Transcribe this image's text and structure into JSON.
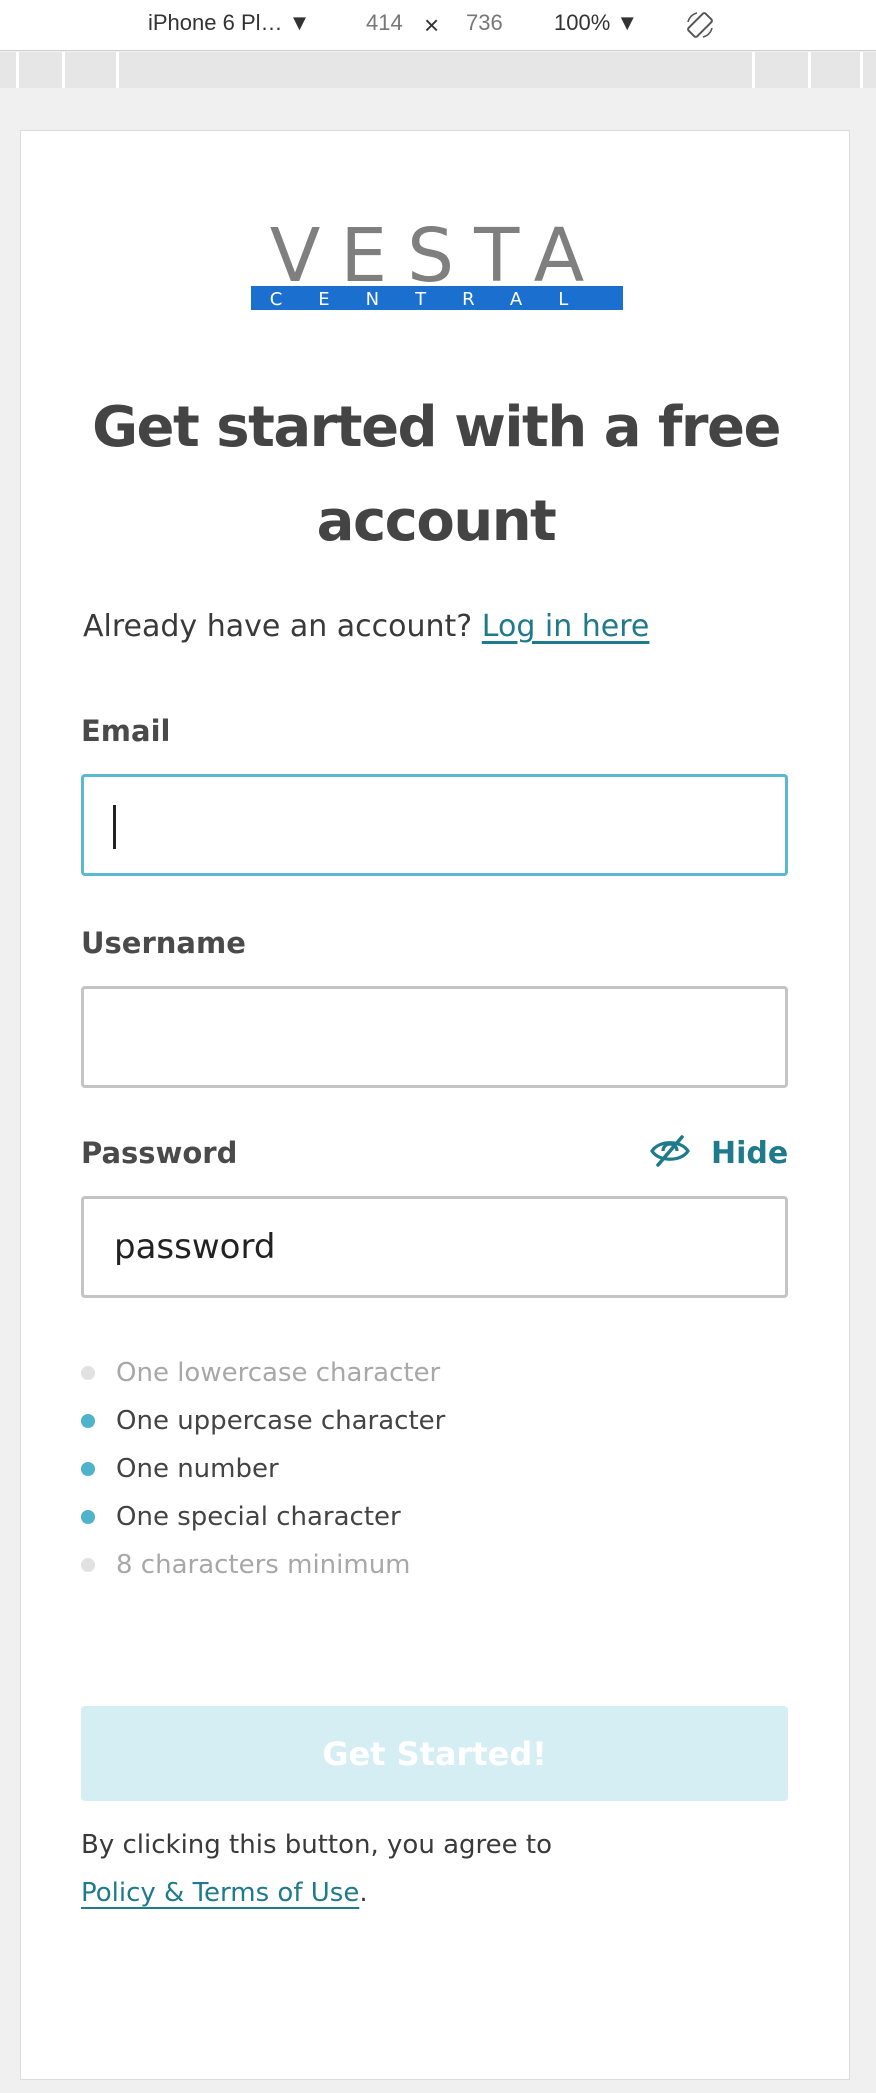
{
  "devtools": {
    "device": "iPhone 6 Pl…",
    "dropdown_arrow": "▼",
    "width": "414",
    "times": "×",
    "height": "736",
    "zoom": "100%",
    "rotate_icon": "rotate-icon"
  },
  "page": {
    "logo": {
      "wordmark": "VESTA",
      "sub": "CENTRAL",
      "sub_color": "#1a6fcf",
      "mark_color": "#7f7f80"
    },
    "heading": "Get started with a free account",
    "already_text": "Already have an account?",
    "login_link": "Log in here",
    "email": {
      "label": "Email",
      "value": "",
      "placeholder": ""
    },
    "username": {
      "label": "Username",
      "value": "",
      "placeholder": ""
    },
    "password": {
      "label": "Password",
      "value": "password",
      "toggle_label": "Hide",
      "toggle_icon": "eye-slash-icon"
    },
    "requirements": [
      {
        "text": "One lowercase character",
        "met": false
      },
      {
        "text": "One uppercase character",
        "met": true
      },
      {
        "text": "One number",
        "met": true
      },
      {
        "text": "One special character",
        "met": true
      },
      {
        "text": "8 characters minimum",
        "met": false
      }
    ],
    "submit_label": "Get Started!",
    "terms_prefix": "By clicking this button, you agree to",
    "terms_link": "Policy & Terms of Use",
    "terms_suffix": ".",
    "accent_color": "#1f7a8c",
    "focus_color": "#5ab8cf"
  }
}
